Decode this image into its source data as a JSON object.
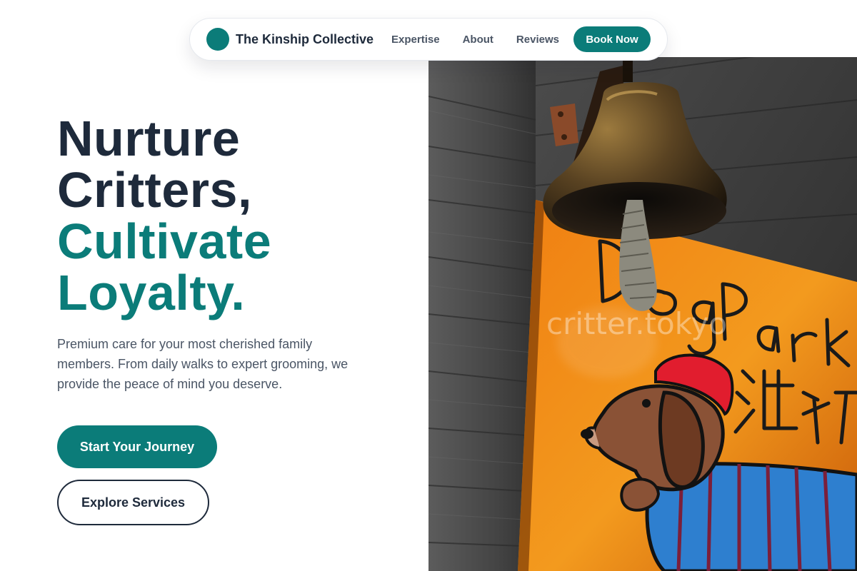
{
  "nav": {
    "brand_name": "The Kinship Collective",
    "links": [
      {
        "label": "Expertise"
      },
      {
        "label": "About"
      },
      {
        "label": "Reviews"
      }
    ],
    "cta_label": "Book Now"
  },
  "hero": {
    "headline": {
      "line1": "Nurture",
      "line2": "Critters,",
      "line3": "Cultivate",
      "line4": "Loyalty."
    },
    "subtitle": "Premium care for your most cherished family members. From daily walks to expert grooming, we provide the peace of mind you deserve.",
    "primary_cta": "Start Your Journey",
    "secondary_cta": "Explore Services"
  },
  "image": {
    "sign_text": "Dog Parking",
    "sign_kanji": "泊狗位",
    "watermark": "critter.tokyo"
  },
  "colors": {
    "accent": "#0b7c79",
    "heading": "#1e2a3b",
    "body": "#4a5565",
    "sign_orange": "#e8760f"
  }
}
